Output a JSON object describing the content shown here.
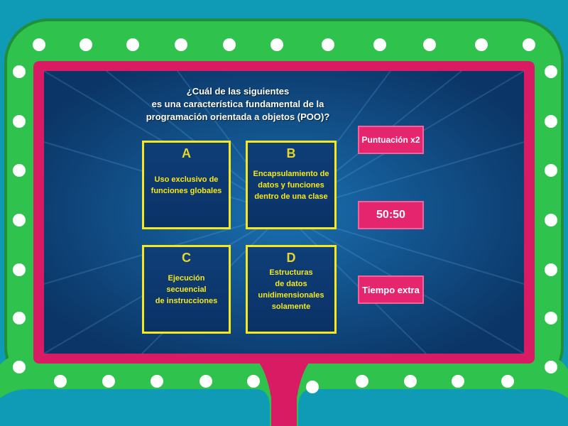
{
  "question": {
    "text": "¿Cuál de las siguientes\nes una característica fundamental de la\nprogramación orientada a objetos (POO)?"
  },
  "answers": [
    {
      "letter": "A",
      "text": "Uso exclusivo de\nfunciones globales"
    },
    {
      "letter": "B",
      "text": "Encapsulamiento de\ndatos y funciones\ndentro de una clase"
    },
    {
      "letter": "C",
      "text": "Ejecución secuencial\nde instrucciones"
    },
    {
      "letter": "D",
      "text": "Estructuras\nde datos\nunidimensionales\nsolamente"
    }
  ],
  "powerups": {
    "double_points": "Puntuación x2",
    "fifty_fifty": "50:50",
    "extra_time": "Tiempo extra"
  },
  "colors": {
    "outer_bg": "#0f9bb5",
    "frame_green": "#2fc24d",
    "frame_pink": "#d81b63",
    "screen_blue": "#0b3f7a",
    "answer_border": "#f6e81c",
    "powerup_bg": "#e5266f"
  }
}
